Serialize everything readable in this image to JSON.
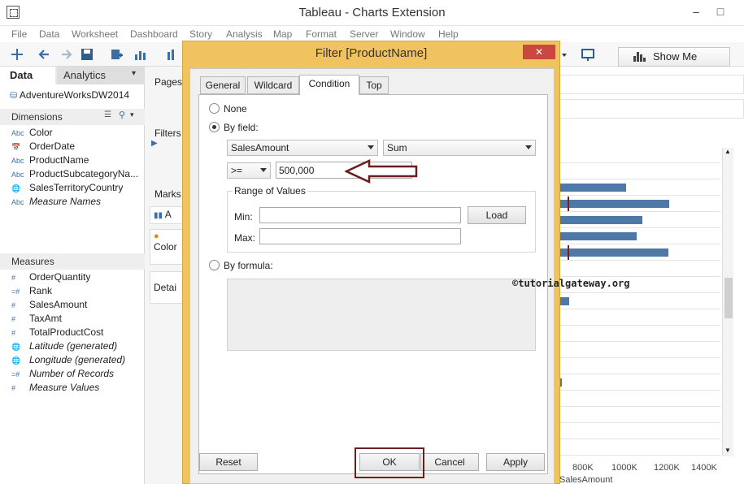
{
  "window": {
    "title": "Tableau - Charts Extension",
    "minimize": "–",
    "restore": "□"
  },
  "menu": [
    "File",
    "Data",
    "Worksheet",
    "Dashboard",
    "Story",
    "Analysis",
    "Map",
    "Format",
    "Server",
    "Window",
    "Help"
  ],
  "toolbar": {
    "show_me_label": "Show Me"
  },
  "data_pane": {
    "tab_data": "Data",
    "tab_analytics": "Analytics",
    "tab_arrow": "▾",
    "datasource": "AdventureWorksDW2014",
    "dimensions_label": "Dimensions",
    "dimensions": [
      {
        "icon": "Abc",
        "label": "Color"
      },
      {
        "icon": "📅",
        "label": "OrderDate"
      },
      {
        "icon": "Abc",
        "label": "ProductName"
      },
      {
        "icon": "Abc",
        "label": "ProductSubcategoryNa..."
      },
      {
        "icon": "🌐",
        "label": "SalesTerritoryCountry"
      },
      {
        "icon": "Abc",
        "label": "Measure Names"
      }
    ],
    "measures_label": "Measures",
    "measures": [
      {
        "icon": "#",
        "label": "OrderQuantity"
      },
      {
        "icon": "=#",
        "label": "Rank"
      },
      {
        "icon": "#",
        "label": "SalesAmount"
      },
      {
        "icon": "#",
        "label": "TaxAmt"
      },
      {
        "icon": "#",
        "label": "TotalProductCost"
      },
      {
        "icon": "🌐",
        "label": "Latitude (generated)"
      },
      {
        "icon": "🌐",
        "label": "Longitude (generated)"
      },
      {
        "icon": "=#",
        "label": "Number of Records"
      },
      {
        "icon": "#",
        "label": "Measure Values"
      }
    ]
  },
  "shelves": {
    "pages": "Pages",
    "filters": "Filters",
    "marks": "Marks",
    "mark_type": "A",
    "color": "Color",
    "detail": "Detai"
  },
  "viz": {
    "axis_ticks": [
      "800K",
      "1000K",
      "1200K",
      "1400K"
    ],
    "axis_title": "SalesAmount"
  },
  "dialog": {
    "title": "Filter [ProductName]",
    "close": "✕",
    "tabs": [
      "General",
      "Wildcard",
      "Condition",
      "Top"
    ],
    "active_tab": "Condition",
    "none_label": "None",
    "by_field_label": "By field:",
    "field_value": "SalesAmount",
    "aggregation_value": "Sum",
    "operator_value": ">=",
    "value_input": "500,000",
    "range_title": "Range of Values",
    "min_label": "Min:",
    "max_label": "Max:",
    "load_button": "Load",
    "by_formula_label": "By formula:",
    "reset_button": "Reset",
    "ok_button": "OK",
    "cancel_button": "Cancel",
    "apply_button": "Apply"
  },
  "watermark": "©tutorialgateway.org",
  "colors": {
    "dialog_frame": "#f0c35f",
    "bar": "#4e79a7",
    "highlight": "#6e1c1c",
    "close": "#c9483f"
  }
}
